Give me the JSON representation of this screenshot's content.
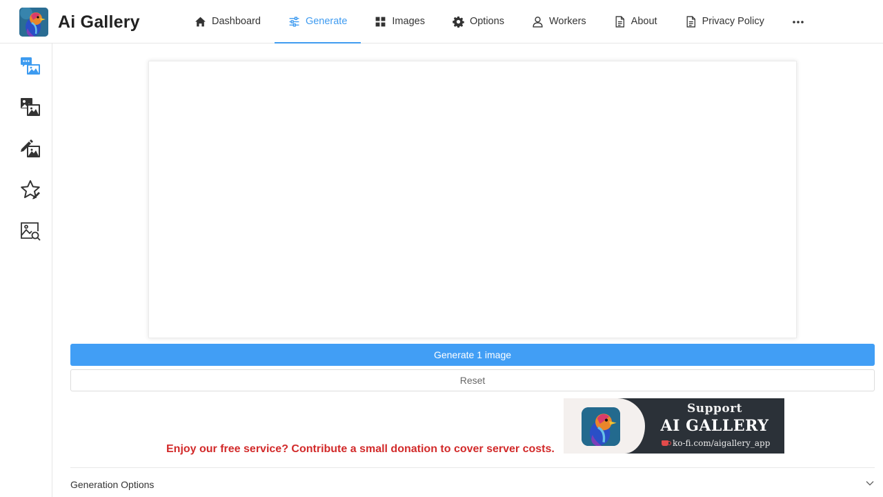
{
  "app": {
    "title": "Ai Gallery"
  },
  "nav": {
    "items": [
      {
        "label": "Dashboard",
        "icon": "home-icon"
      },
      {
        "label": "Generate",
        "icon": "sliders-icon",
        "active": true
      },
      {
        "label": "Images",
        "icon": "grid-icon"
      },
      {
        "label": "Options",
        "icon": "gear-icon"
      },
      {
        "label": "Workers",
        "icon": "user-icon"
      },
      {
        "label": "About",
        "icon": "document-icon"
      },
      {
        "label": "Privacy Policy",
        "icon": "document-icon"
      }
    ],
    "more_icon": "more-dots-icon"
  },
  "sidebar": {
    "items": [
      {
        "icon": "text-to-image-icon"
      },
      {
        "icon": "image-to-image-icon"
      },
      {
        "icon": "inpaint-icon"
      },
      {
        "icon": "favorites-star-icon"
      },
      {
        "icon": "image-search-icon"
      }
    ]
  },
  "actions": {
    "generate_label": "Generate 1 image",
    "reset_label": "Reset"
  },
  "donation": {
    "message": "Enjoy our free service? Contribute a small donation to cover server costs.",
    "banner_support": "Support",
    "banner_name": "AI GALLERY",
    "banner_url": "ko-fi.com/aigallery_app"
  },
  "generation_options": {
    "label": "Generation Options"
  },
  "colors": {
    "accent": "#419ef5",
    "donation_text": "#d22a2a",
    "banner_bg": "#2b3138"
  }
}
